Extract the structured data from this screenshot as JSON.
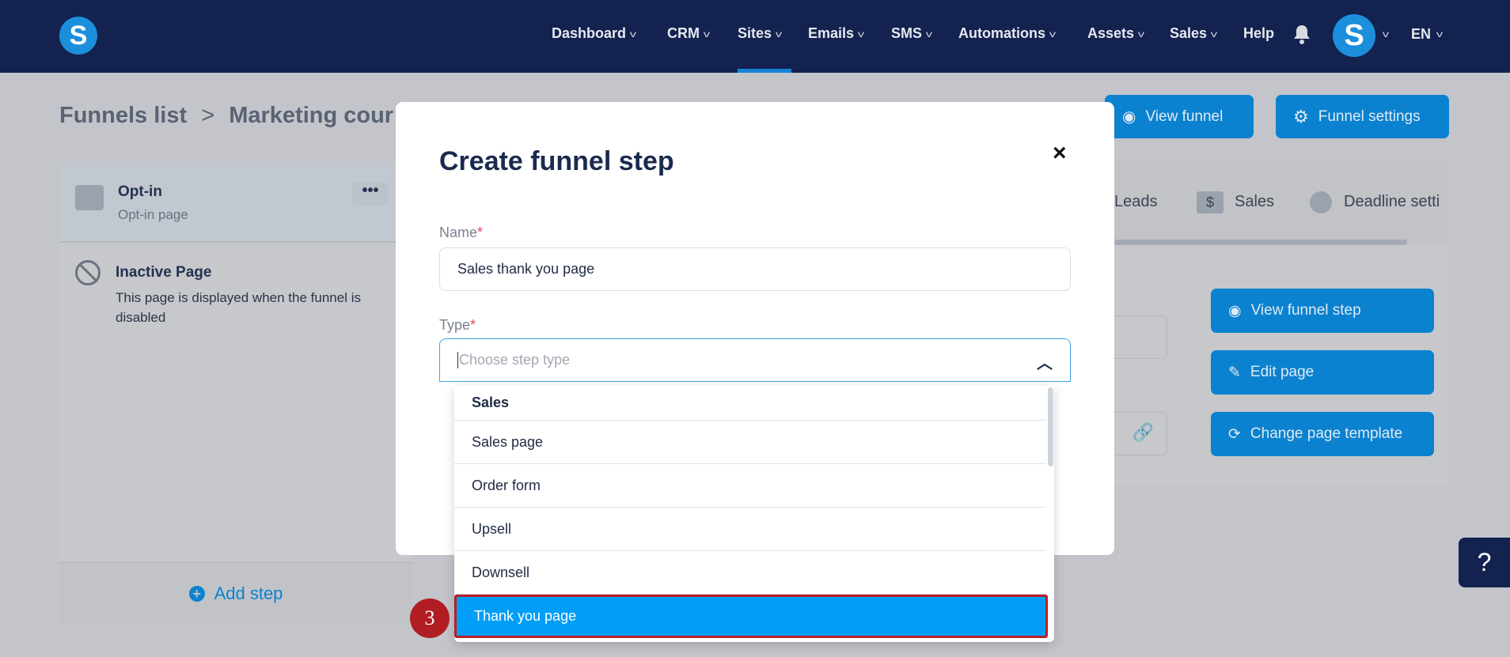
{
  "header": {
    "logo": "S",
    "nav": [
      {
        "label": "Dashboard",
        "chevron": true
      },
      {
        "label": "CRM",
        "chevron": true
      },
      {
        "label": "Sites",
        "chevron": true,
        "active": true
      },
      {
        "label": "Emails",
        "chevron": true
      },
      {
        "label": "SMS",
        "chevron": true
      },
      {
        "label": "Automations",
        "chevron": true
      },
      {
        "label": "Assets",
        "chevron": true
      },
      {
        "label": "Sales",
        "chevron": true
      },
      {
        "label": "Help",
        "chevron": false
      }
    ],
    "avatar": "S",
    "language": "EN"
  },
  "breadcrumb": {
    "root": "Funnels list",
    "separator": ">",
    "current": "Marketing cour"
  },
  "actions": {
    "view_funnel": "View funnel",
    "funnel_settings": "Funnel settings"
  },
  "steps": [
    {
      "title": "Opt-in",
      "subtitle": "Opt-in page"
    }
  ],
  "inactive": {
    "title": "Inactive Page",
    "text": "This page is displayed when the funnel is disabled"
  },
  "add_step": "Add step",
  "tabs": [
    "Leads",
    "Sales",
    "Deadline setti"
  ],
  "step_actions": {
    "view_step": "View funnel step",
    "edit_page": "Edit page",
    "change_template": "Change page template"
  },
  "modal": {
    "title": "Create funnel step",
    "close": "×",
    "name_label": "Name",
    "name_value": "Sales thank you page",
    "type_label": "Type",
    "required": "*",
    "type_placeholder": "Choose step type",
    "dropdown": {
      "group": "Sales",
      "options": [
        "Sales page",
        "Order form",
        "Upsell",
        "Downsell",
        "Thank you page"
      ],
      "highlighted": "Thank you page"
    }
  },
  "annotation": "3",
  "help": "?",
  "colors": {
    "header": "#13224f",
    "accent": "#009ef7",
    "annotation": "#b01e23"
  }
}
